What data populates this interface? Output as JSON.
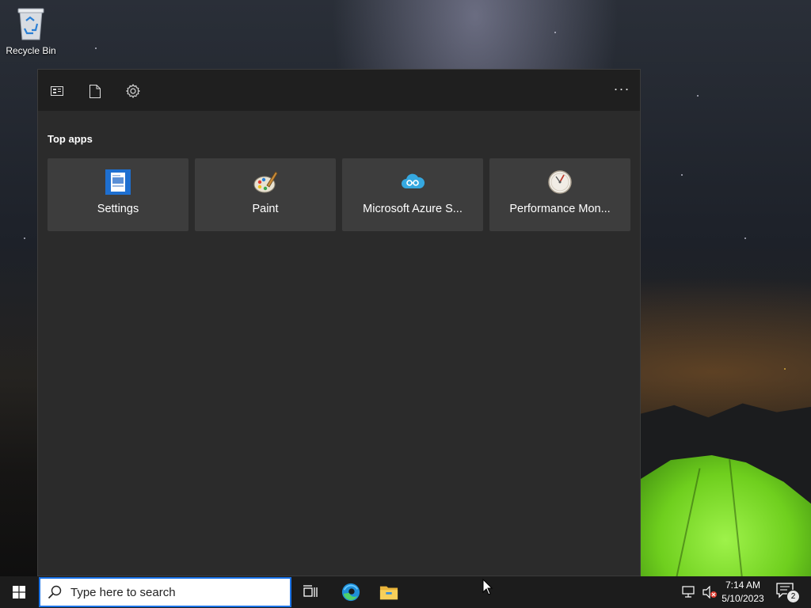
{
  "desktop": {
    "recycle_bin_label": "Recycle Bin",
    "recycle_bin_icon": "recycle-bin-icon"
  },
  "start_panel": {
    "header_buttons": [
      {
        "name": "apps-view",
        "icon": "apps-icon"
      },
      {
        "name": "documents",
        "icon": "document-icon"
      },
      {
        "name": "settings",
        "icon": "gear-icon"
      }
    ],
    "more_label": "···",
    "section_title": "Top apps",
    "top_apps": [
      {
        "label": "Settings",
        "icon": "settings-app-icon"
      },
      {
        "label": "Paint",
        "icon": "paint-palette-icon"
      },
      {
        "label": "Microsoft Azure S...",
        "icon": "azure-cloud-icon"
      },
      {
        "label": "Performance Mon...",
        "icon": "performance-gauge-icon"
      }
    ]
  },
  "taskbar": {
    "search_placeholder": "Type here to search",
    "pinned": [
      "task-view-icon",
      "edge-icon",
      "file-explorer-icon"
    ],
    "clock_time": "7:14 AM",
    "clock_date": "5/10/2023",
    "notification_count": "2"
  },
  "colors": {
    "panel_bg": "#2b2b2b",
    "panel_header_bg": "#1f1f1f",
    "tile_bg": "#3d3d3d",
    "taskbar_bg": "#1c1c1c",
    "search_border": "#1a73e8"
  }
}
